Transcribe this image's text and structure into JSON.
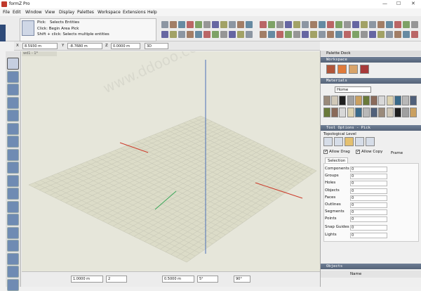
{
  "titlebar": {
    "title": "formZ Pro",
    "min": "—",
    "max": "☐",
    "close": "✕"
  },
  "menu": [
    "File",
    "Edit",
    "Window",
    "View",
    "Display",
    "Palettes",
    "Workspace",
    "Extensions",
    "Help"
  ],
  "hint": {
    "title": "Pick:",
    "line1": "Selects Entities",
    "line2": "Click: Begin Area Pick",
    "line3": "Shift + click: Selects multiple entities"
  },
  "sidetab": "Tool Options",
  "coords": {
    "x_label": "X",
    "x": "8.5930 m",
    "y_label": "Y",
    "y": "-8.7680 m",
    "z_label": "Z",
    "z": "0.0000 m",
    "mode": "3D"
  },
  "viewport": {
    "tab": "wd1 - 1*"
  },
  "status": {
    "grid": "1.0000 m",
    "grid2": "2",
    "angle": "0.5000 m",
    "angle2": "5°",
    "degree": "90°"
  },
  "dock": {
    "title": "Palette Dock",
    "workspace": "Workspace",
    "materials": "Materials",
    "home": "Home",
    "tool_options": "Tool Options - Pick",
    "topological_level": "Topological Level",
    "allow_drag": "Allow Drag",
    "allow_copy": "Allow Copy",
    "frame": "Frame",
    "selection": "Selection",
    "rows": [
      {
        "label": "Components",
        "value": "0"
      },
      {
        "label": "Groups",
        "value": "0"
      },
      {
        "label": "Holes",
        "value": "0"
      },
      {
        "label": "Objects",
        "value": "0"
      },
      {
        "label": "Faces",
        "value": "0"
      },
      {
        "label": "Outlines",
        "value": "0"
      },
      {
        "label": "Segments",
        "value": "0"
      },
      {
        "label": "Points",
        "value": "0"
      }
    ],
    "rows2": [
      {
        "label": "Snap Guides",
        "value": "0"
      },
      {
        "label": "Lights",
        "value": "0"
      }
    ],
    "objects": "Objects",
    "name_col": "Name"
  },
  "colors": {
    "dock_header": "#556378",
    "viewport": "#e6e6da",
    "grid_line": "#c9c9b8",
    "axis_x": "#cc3a2a",
    "axis_y": "#3aa85a",
    "axis_z": "#4a6fb8"
  }
}
